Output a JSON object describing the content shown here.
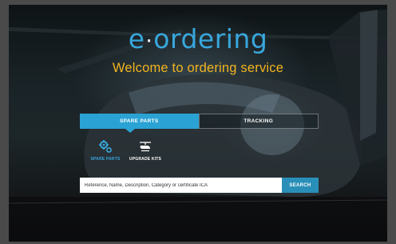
{
  "header": {
    "logo_prefix": "e",
    "logo_dot": "·",
    "logo_suffix": "ordering",
    "welcome": "Welcome to ordering service"
  },
  "tabs": [
    {
      "label": "SPARE PARTS",
      "active": true
    },
    {
      "label": "TRACKING",
      "active": false
    }
  ],
  "sub_options": [
    {
      "label": "SPARE PARTS",
      "icon": "gears-icon",
      "selected": true
    },
    {
      "label": "UPGRADE KITS",
      "icon": "helicopter-icon",
      "selected": false
    }
  ],
  "search": {
    "placeholder": "Reference, Name, Description, Category or certificate ICA",
    "button_label": "SEARCH"
  },
  "colors": {
    "accent": "#2aa2d4",
    "logo": "#38a7dc",
    "welcome": "#f2b41e"
  }
}
